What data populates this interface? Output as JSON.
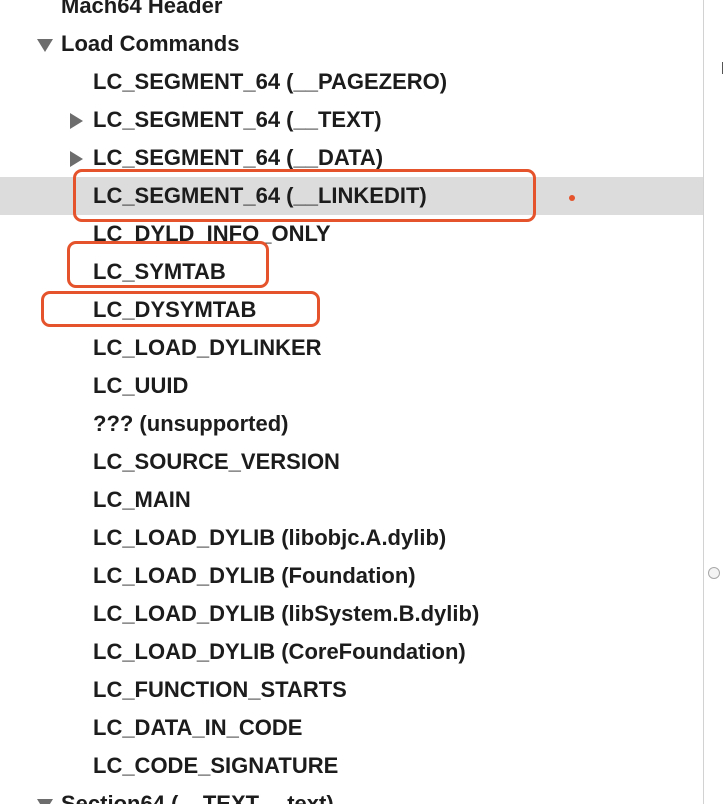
{
  "tree": {
    "rows": [
      {
        "label": "Mach64 Header",
        "level": 0,
        "disclosure": "none",
        "selected": false
      },
      {
        "label": "Load Commands",
        "level": 0,
        "disclosure": "expanded",
        "selected": false
      },
      {
        "label": "LC_SEGMENT_64 (__PAGEZERO)",
        "level": 1,
        "disclosure": "none",
        "selected": false
      },
      {
        "label": "LC_SEGMENT_64 (__TEXT)",
        "level": 1,
        "disclosure": "collapsed",
        "selected": false
      },
      {
        "label": "LC_SEGMENT_64 (__DATA)",
        "level": 1,
        "disclosure": "collapsed",
        "selected": false
      },
      {
        "label": "LC_SEGMENT_64 (__LINKEDIT)",
        "level": 1,
        "disclosure": "none",
        "selected": true
      },
      {
        "label": "LC_DYLD_INFO_ONLY",
        "level": 1,
        "disclosure": "none",
        "selected": false
      },
      {
        "label": "LC_SYMTAB",
        "level": 1,
        "disclosure": "none",
        "selected": false
      },
      {
        "label": "LC_DYSYMTAB",
        "level": 1,
        "disclosure": "none",
        "selected": false
      },
      {
        "label": "LC_LOAD_DYLINKER",
        "level": 1,
        "disclosure": "none",
        "selected": false
      },
      {
        "label": "LC_UUID",
        "level": 1,
        "disclosure": "none",
        "selected": false
      },
      {
        "label": "??? (unsupported)",
        "level": 1,
        "disclosure": "none",
        "selected": false
      },
      {
        "label": "LC_SOURCE_VERSION",
        "level": 1,
        "disclosure": "none",
        "selected": false
      },
      {
        "label": "LC_MAIN",
        "level": 1,
        "disclosure": "none",
        "selected": false
      },
      {
        "label": "LC_LOAD_DYLIB (libobjc.A.dylib)",
        "level": 1,
        "disclosure": "none",
        "selected": false
      },
      {
        "label": "LC_LOAD_DYLIB (Foundation)",
        "level": 1,
        "disclosure": "none",
        "selected": false
      },
      {
        "label": "LC_LOAD_DYLIB (libSystem.B.dylib)",
        "level": 1,
        "disclosure": "none",
        "selected": false
      },
      {
        "label": "LC_LOAD_DYLIB (CoreFoundation)",
        "level": 1,
        "disclosure": "none",
        "selected": false
      },
      {
        "label": "LC_FUNCTION_STARTS",
        "level": 1,
        "disclosure": "none",
        "selected": false
      },
      {
        "label": "LC_DATA_IN_CODE",
        "level": 1,
        "disclosure": "none",
        "selected": false
      },
      {
        "label": "LC_CODE_SIGNATURE",
        "level": 1,
        "disclosure": "none",
        "selected": false
      },
      {
        "label": "Section64 (__TEXT,__text)",
        "level": 0,
        "disclosure": "expanded",
        "selected": false
      }
    ]
  },
  "annotations": {
    "highlighted_rows": [
      "LC_SEGMENT_64 (__LINKEDIT)",
      "LC_SYMTAB",
      "LC_DYSYMTAB"
    ],
    "color": "#e4532b"
  },
  "colors": {
    "selection": "#dcdcdc",
    "text": "#1c1c1c",
    "disclosure": "#6d6d6d"
  }
}
